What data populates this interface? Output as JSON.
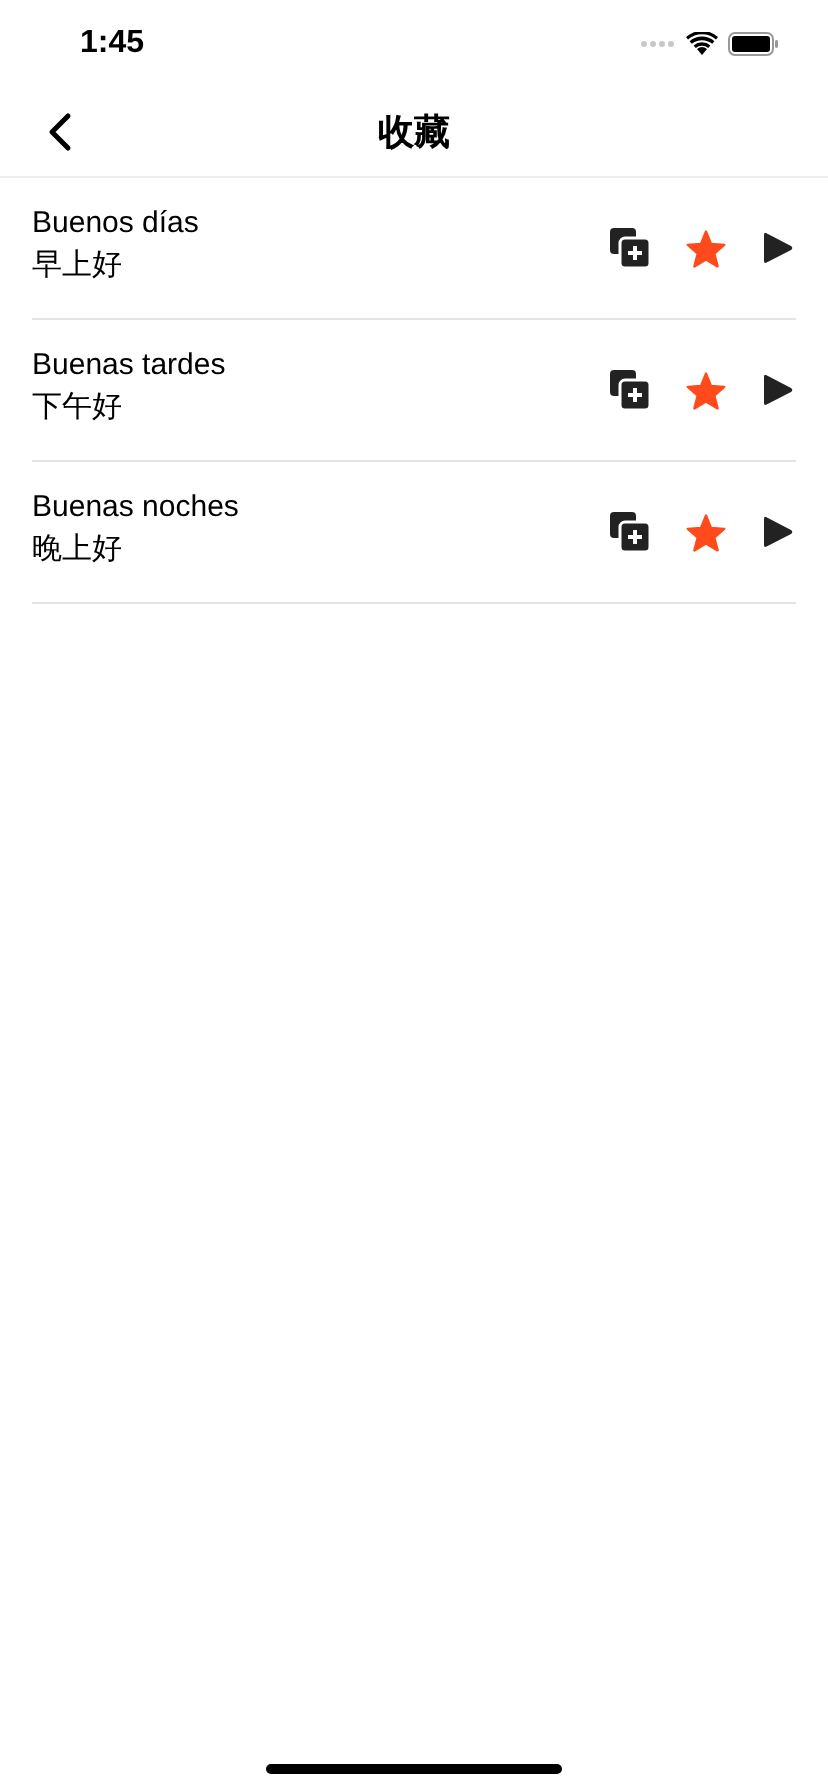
{
  "status_bar": {
    "time": "1:45"
  },
  "nav": {
    "title": "收藏"
  },
  "phrases": [
    {
      "spanish": "Buenos días",
      "chinese": "早上好",
      "favorite": true
    },
    {
      "spanish": "Buenas tardes",
      "chinese": "下午好",
      "favorite": true
    },
    {
      "spanish": "Buenas noches",
      "chinese": "晚上好",
      "favorite": true
    }
  ]
}
